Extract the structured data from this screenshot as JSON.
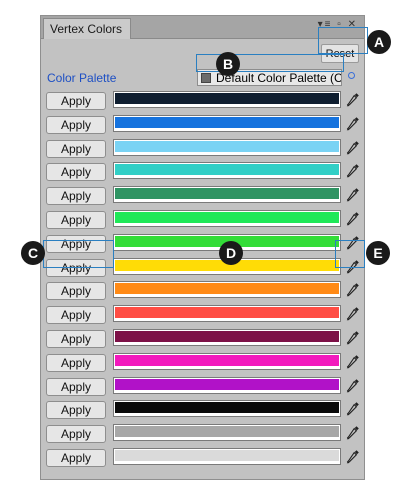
{
  "window": {
    "tab_title": "Vertex Colors",
    "tab_icons": "▾≡ ▫ ✕"
  },
  "toolbar": {
    "reset_label": "Reset"
  },
  "palette": {
    "label": "Color Palette",
    "field_value": "Default Color Palette (Co"
  },
  "rows": [
    {
      "apply_label": "Apply",
      "color": "#0f1e30"
    },
    {
      "apply_label": "Apply",
      "color": "#1673de"
    },
    {
      "apply_label": "Apply",
      "color": "#7ad3f4"
    },
    {
      "apply_label": "Apply",
      "color": "#31cfc6"
    },
    {
      "apply_label": "Apply",
      "color": "#2f9463"
    },
    {
      "apply_label": "Apply",
      "color": "#1fe858"
    },
    {
      "apply_label": "Apply",
      "color": "#33dd38"
    },
    {
      "apply_label": "Apply",
      "color": "#ffdc06"
    },
    {
      "apply_label": "Apply",
      "color": "#ff8a16"
    },
    {
      "apply_label": "Apply",
      "color": "#ff4d44"
    },
    {
      "apply_label": "Apply",
      "color": "#7d1147"
    },
    {
      "apply_label": "Apply",
      "color": "#f21abd"
    },
    {
      "apply_label": "Apply",
      "color": "#b112c8"
    },
    {
      "apply_label": "Apply",
      "color": "#0a0a0a"
    },
    {
      "apply_label": "Apply",
      "color": "#a7a7a7"
    },
    {
      "apply_label": "Apply",
      "color": "#dadada"
    }
  ],
  "callouts": {
    "a": "A",
    "b": "B",
    "c": "C",
    "d": "D",
    "e": "E"
  },
  "colors": {
    "callout_outline": "#2a7fc1",
    "label_blue": "#1d4fc4"
  }
}
